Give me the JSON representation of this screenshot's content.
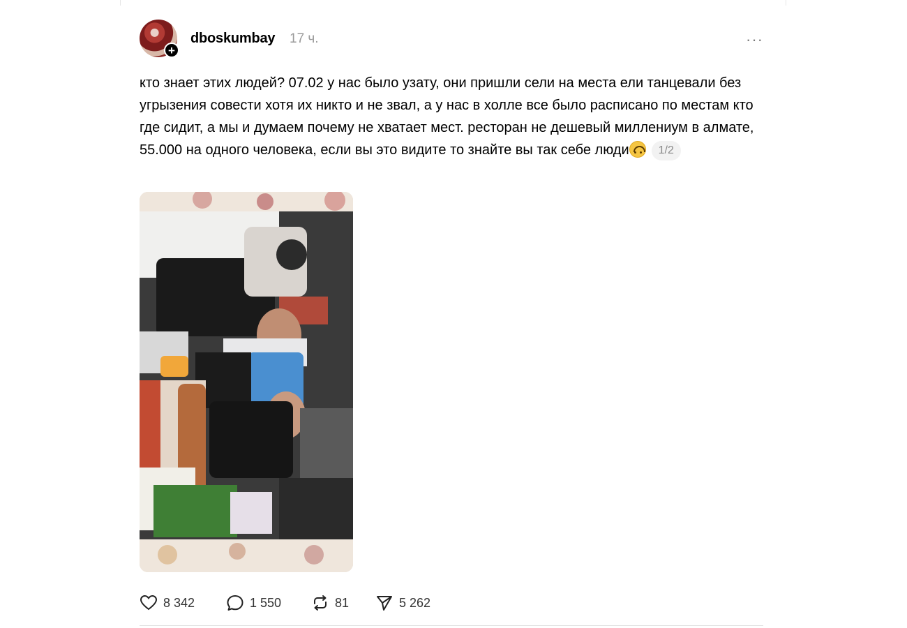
{
  "post": {
    "username": "dboskumbay",
    "time": "17 ч.",
    "more_label": "···",
    "follow_badge": "+",
    "text": "кто знает этих людей? 07.02 у нас было узату, они пришли сели на места ели танцевали без угрызения совести хотя их никто и не звал, а у нас в холле все было расписано по местам кто где сидит, а мы и думаем почему не хватает мест. ресторан не дешевый миллениум в алмате, 55.000 на одного человека, если вы это видите то знайте вы так себе люди",
    "emoji_icon": "upside-down-face-emoji",
    "image_counter": "1/2",
    "image_description_icon": "photo-of-people-at-banquet"
  },
  "actions": {
    "likes": "8 342",
    "comments": "1 550",
    "reposts": "81",
    "shares": "5 262"
  },
  "colors": {
    "time": "#9a9a9a",
    "counter_bg": "#f2f2f2",
    "badge": "#000000"
  }
}
